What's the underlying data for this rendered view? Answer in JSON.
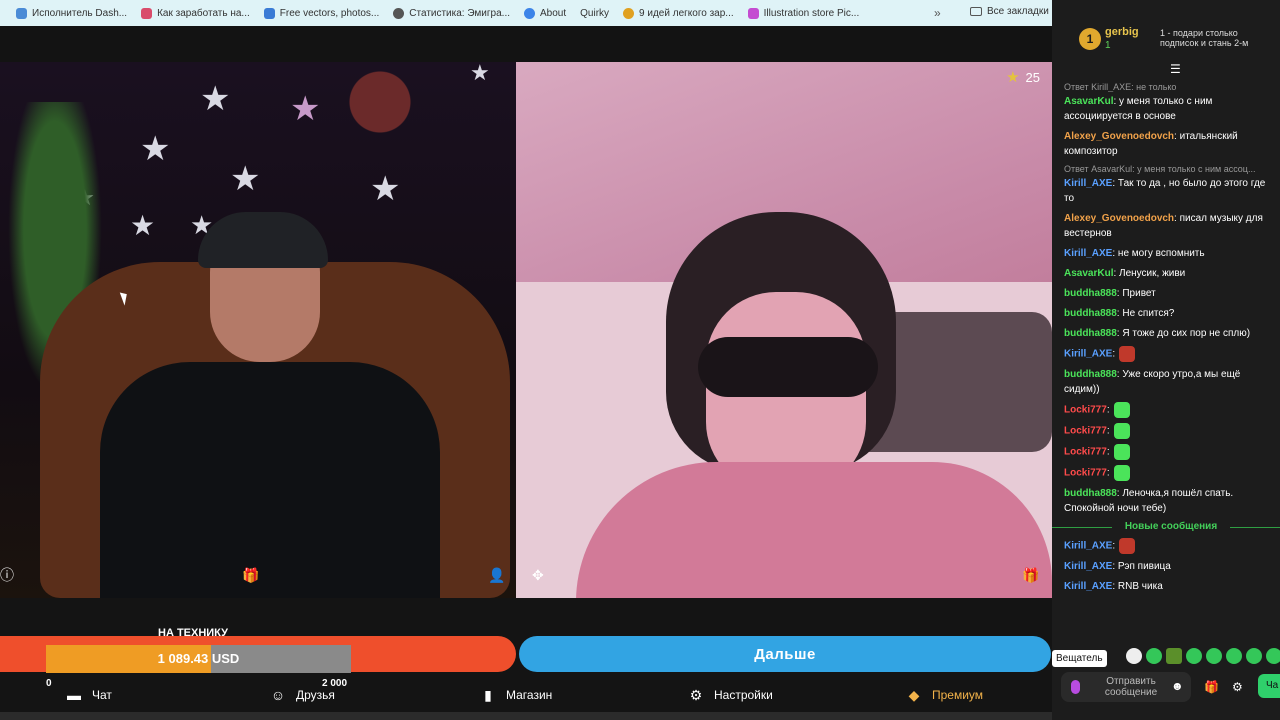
{
  "bookmarks": {
    "items": [
      {
        "label": "Исполнитель Dash...",
        "icon": "page-icon",
        "color": "#4a8bd6"
      },
      {
        "label": "Как заработать на...",
        "icon": "page-icon",
        "color": "#d94b6b"
      },
      {
        "label": "Free vectors, photos...",
        "icon": "page-icon",
        "color": "#3a7bd5"
      },
      {
        "label": "Статистика: Эмигра...",
        "icon": "globe-icon",
        "color": "#555555"
      },
      {
        "label": "About",
        "icon": "page-icon",
        "color": "#3c84e8"
      },
      {
        "label": "Quirky",
        "icon": "page-icon",
        "color": "#777777"
      },
      {
        "label": "9 идей легкого зар...",
        "icon": "page-icon",
        "color": "#e0a020"
      },
      {
        "label": "Illustration store Pic...",
        "icon": "page-icon",
        "color": "#c44bd1"
      }
    ],
    "more": "»",
    "all_label": "Все закладки"
  },
  "video": {
    "likes_count": "25"
  },
  "goal": {
    "title": "НА ТЕХНИКУ",
    "amount": "1 089.43 USD",
    "progress": 0.54
  },
  "next_button": "Дальше",
  "nav": {
    "chat": {
      "label": "Чат",
      "badge": "0"
    },
    "friends": {
      "label": "Друзья",
      "badge": "2 000"
    },
    "shop": {
      "label": "Магазин"
    },
    "settings": {
      "label": "Настройки"
    },
    "premium": {
      "label": "Премиум"
    }
  },
  "chat": {
    "rank": {
      "number": "1",
      "name": "gerbig",
      "count": "1",
      "hint": "1 - подари столько подписок и стань 2-м"
    },
    "messages": [
      {
        "reply": "Ответ Kirill_AXE: не только",
        "name": "AsavarKul",
        "color": "#4be45a",
        "text": ": у меня только с ним ассоциируется в основе"
      },
      {
        "reply": "",
        "name": "Alexey_Govenoedovch",
        "color": "#f1a24a",
        "text": ": итальянский композитор"
      },
      {
        "reply": "Ответ AsavarKul: у меня только с ним ассоц...",
        "name": "Kirill_AXE",
        "color": "#5aa0ff",
        "text": ": Так то да , но было до этого где то"
      },
      {
        "reply": "",
        "name": "Alexey_Govenoedovch",
        "color": "#f1a24a",
        "text": ": писал музыку для вестернов"
      },
      {
        "reply": "",
        "name": "Kirill_AXE",
        "color": "#5aa0ff",
        "text": ": не могу вспомнить"
      },
      {
        "reply": "",
        "name": "AsavarKul",
        "color": "#4be45a",
        "text": ": Ленусик, живи"
      },
      {
        "reply": "",
        "name": "buddha888",
        "color": "#4be45a",
        "text": ": Привет"
      },
      {
        "reply": "",
        "name": "buddha888",
        "color": "#4be45a",
        "text": ": Не спится?"
      },
      {
        "reply": "",
        "name": "buddha888",
        "color": "#4be45a",
        "text": ": Я тоже до сих пор не сплю)"
      },
      {
        "reply": "",
        "name": "Kirill_AXE",
        "color": "#5aa0ff",
        "text": ":"
      },
      {
        "reply": "",
        "name": "buddha888",
        "color": "#4be45a",
        "text": ": Уже скоро утро,а мы ещё сидим))"
      },
      {
        "reply": "",
        "name": "Locki777",
        "color": "#ff4b4b",
        "text": ":"
      },
      {
        "reply": "",
        "name": "Locki777",
        "color": "#ff4b4b",
        "text": ":"
      },
      {
        "reply": "",
        "name": "Locki777",
        "color": "#ff4b4b",
        "text": ":"
      },
      {
        "reply": "",
        "name": "Locki777",
        "color": "#ff4b4b",
        "text": ":"
      },
      {
        "reply": "",
        "name": "buddha888",
        "color": "#4be45a",
        "text": ": Леночка,я пошёл спать. Спокойной ночи тебе)"
      }
    ],
    "new_messages_label": "Новые сообщения",
    "new_messages": [
      {
        "name": "Kirill_AXE",
        "color": "#5aa0ff",
        "text": ":"
      },
      {
        "name": "Kirill_AXE",
        "color": "#5aa0ff",
        "text": ": Рэп пивица"
      },
      {
        "name": "Kirill_AXE",
        "color": "#5aa0ff",
        "text": ": RNB чика"
      }
    ],
    "tooltip": "Вещатель",
    "send_label": "Отправить сообщение",
    "chat_button": "Ча"
  }
}
